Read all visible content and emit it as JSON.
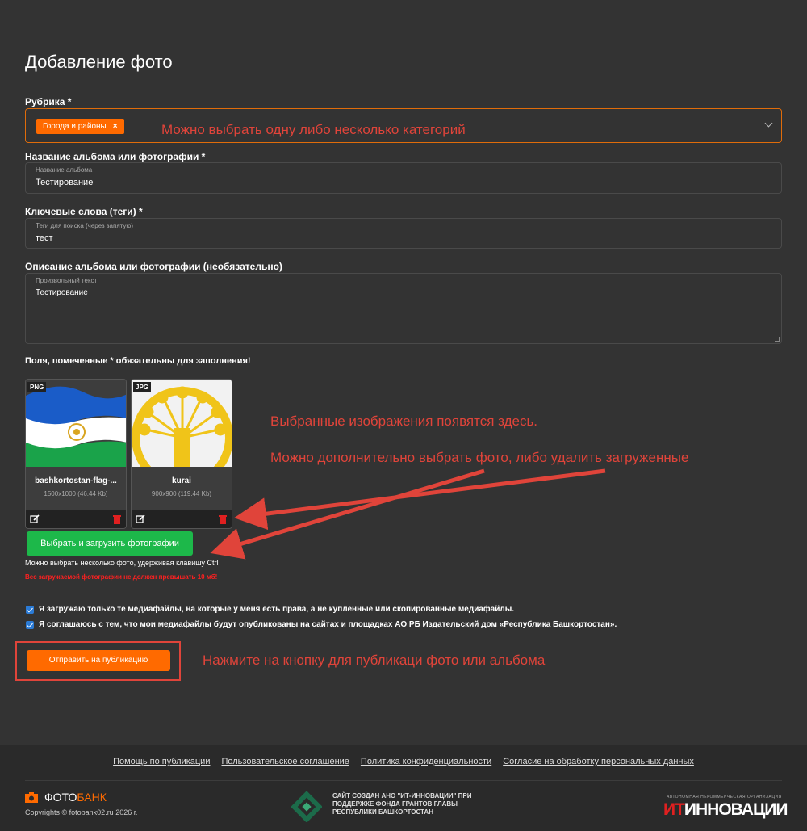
{
  "page": {
    "title": "Добавление фото"
  },
  "form": {
    "category_label": "Рубрика *",
    "category_tag": "Города и районы",
    "category_tag_remove": "×",
    "album_label": "Название альбома или фотографии *",
    "album_placeholder": "Название альбома",
    "album_value": "Тестирование",
    "tags_label": "Ключевые слова (теги) *",
    "tags_placeholder": "Теги для поиска (через запятую)",
    "tags_value": "тест",
    "desc_label": "Описание альбома или фотографии (необязательно)",
    "desc_placeholder": "Произвольный текст",
    "desc_value": "Тестирование",
    "required_note": "Поля, помеченные * обязательны для заполнения!"
  },
  "images": [
    {
      "badge": "PNG",
      "name": "bashkortostan-flag-...",
      "meta": "1500x1000 (46.44 Kb)"
    },
    {
      "badge": "JPG",
      "name": "kurai",
      "meta": "900x900 (119.44 Kb)"
    }
  ],
  "upload": {
    "button": "Выбрать и загрузить фотографии",
    "hint": "Можно выбрать несколько фото, удерживая клавишу Ctrl",
    "warning": "Вес загружаемой фотографии не должен превышать 10 мб!"
  },
  "consents": [
    "Я загружаю только те медиафайлы, на которые у меня есть права, а не купленные или скопированные медиафайлы.",
    "Я соглашаюсь с тем, что мои медиафайлы будут опубликованы на сайтах и площадках АО РБ Издательский дом «Республика Башкортостан»."
  ],
  "submit": {
    "label": "Отправить на публикацию"
  },
  "annotations": {
    "category": "Можно выбрать одну либо несколько категорий",
    "images1": "Выбранные изображения появятся здесь.",
    "images2": "Можно дополнительно выбрать фото, либо удалить загруженные",
    "submit": "Нажмите на кнопку для публикаци фото или альбома"
  },
  "footer": {
    "links": [
      "Помощь по публикации",
      "Пользовательское соглашение",
      "Политика конфиденциальности",
      "Согласие на обработку персональных данных"
    ],
    "logo_a": "ФОТО",
    "logo_b": "БАНК",
    "copyright": "Copyrights © fotobank02.ru 2026 г.",
    "center_text": "САЙТ СОЗДАН АНО \"ИТ-ИННОВАЦИИ\" ПРИ ПОДДЕРЖКЕ ФОНДА ГРАНТОВ ГЛАВЫ РЕСПУБЛИКИ БАШКОРТОСТАН",
    "partner_small": "АВТОНОМНАЯ НЕКОММЕРЧЕСКАЯ ОРГАНИЗАЦИЯ",
    "partner_a": "ИТ",
    "partner_b": "ИННОВАЦИИ"
  },
  "colors": {
    "accent": "#ff6a00",
    "annotation": "#e0443a",
    "green": "#1db84a",
    "bg": "#333333"
  }
}
